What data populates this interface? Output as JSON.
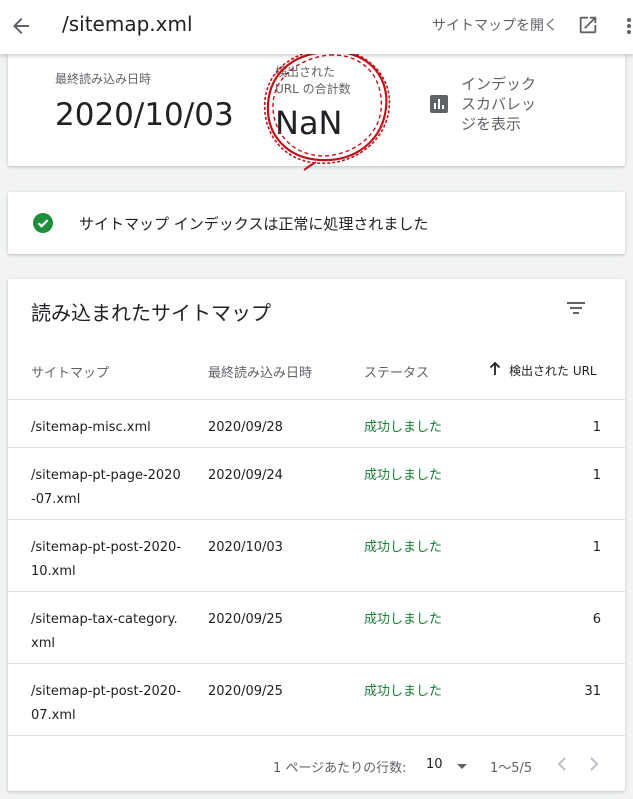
{
  "header": {
    "title": "/sitemap.xml",
    "open_sitemap_label": "サイトマップを開く"
  },
  "summary": {
    "last_read_label": "最終読み込み日時",
    "last_read_value": "2020/10/03",
    "discovered_label_line1": "検出された",
    "discovered_label_line2": "URL の合計数",
    "discovered_value": "NaN",
    "coverage_line1": "インデック",
    "coverage_line2": "スカバレッ",
    "coverage_line3": "ジを表示"
  },
  "status": {
    "message": "サイトマップ インデックスは正常に処理されました",
    "color": "#1e8e3e"
  },
  "table": {
    "title": "読み込まれたサイトマップ",
    "columns": {
      "sitemap": "サイトマップ",
      "last_read": "最終読み込み日時",
      "status": "ステータス",
      "discovered": "検出された URL"
    },
    "rows": [
      {
        "sitemap": "/sitemap-misc.xml",
        "date": "2020/09/28",
        "status": "成功しました",
        "count": "1"
      },
      {
        "sitemap": "/sitemap-pt-page-2020-07.xml",
        "date": "2020/09/24",
        "status": "成功しました",
        "count": "1"
      },
      {
        "sitemap": "/sitemap-pt-post-2020-10.xml",
        "date": "2020/10/03",
        "status": "成功しました",
        "count": "1"
      },
      {
        "sitemap": "/sitemap-tax-category.xml",
        "date": "2020/09/25",
        "status": "成功しました",
        "count": "6"
      },
      {
        "sitemap": "/sitemap-pt-post-2020-07.xml",
        "date": "2020/09/25",
        "status": "成功しました",
        "count": "31"
      }
    ]
  },
  "pagination": {
    "rows_per_page_label": "1 ページあたりの行数:",
    "rows_per_page_value": "10",
    "range": "1〜5/5"
  },
  "colors": {
    "success": "#188038",
    "annotation": "#c0141c"
  }
}
